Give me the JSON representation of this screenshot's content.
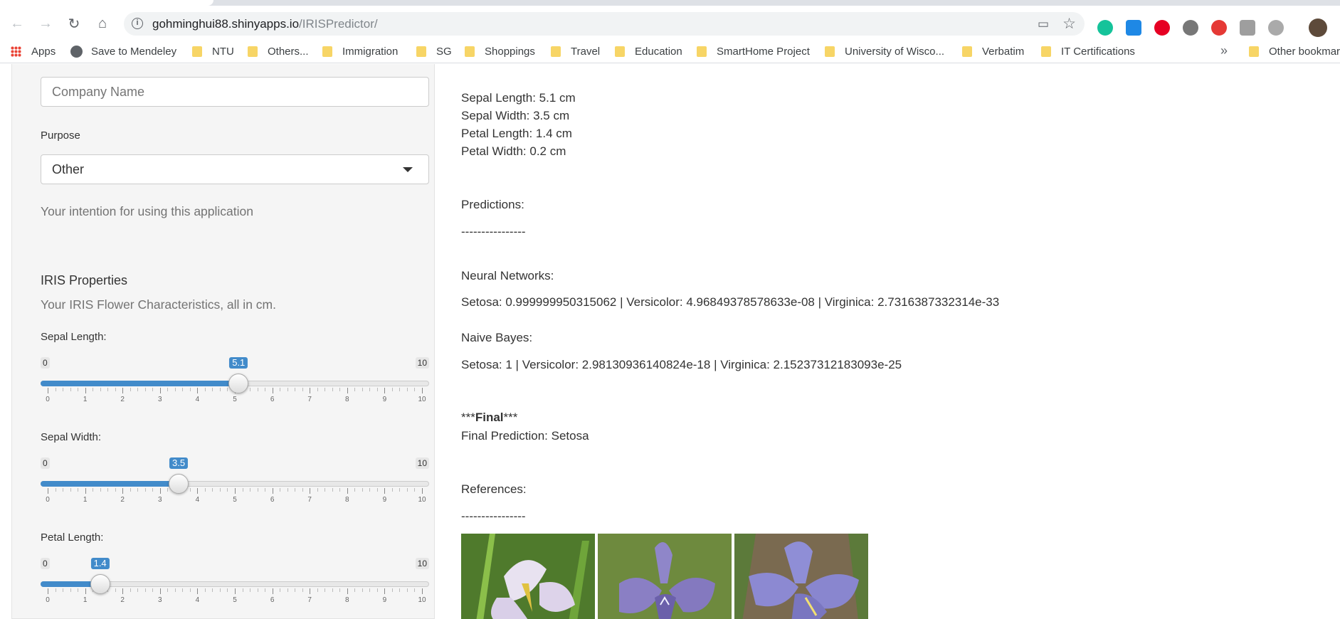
{
  "browser": {
    "url_host": "gohminghui88.shinyapps.io",
    "url_path": "/IRISPredictor/",
    "bookmarks": [
      "Apps",
      "Save to Mendeley",
      "NTU",
      "Others...",
      "Immigration",
      "SG",
      "Shoppings",
      "Travel",
      "Education",
      "SmartHome Project",
      "University of Wisco...",
      "Verbatim",
      "IT Certifications"
    ],
    "overflow": "»",
    "other_bookmarks": "Other bookmar"
  },
  "sidebar": {
    "company_placeholder": "Company Name",
    "purpose_label": "Purpose",
    "purpose_value": "Other",
    "purpose_help": "Your intention for using this application",
    "iris_title": "IRIS Properties",
    "iris_help": "Your IRIS Flower Characteristics, all in cm.",
    "sliders": [
      {
        "label": "Sepal Length:",
        "min": "0",
        "max": "10",
        "value": "5.1",
        "fraction": 0.51
      },
      {
        "label": "Sepal Width:",
        "min": "0",
        "max": "10",
        "value": "3.5",
        "fraction": 0.35
      },
      {
        "label": "Petal Length:",
        "min": "0",
        "max": "10",
        "value": "1.4",
        "fraction": 0.14
      }
    ],
    "tick_labels": [
      "0",
      "1",
      "2",
      "3",
      "4",
      "5",
      "6",
      "7",
      "8",
      "9",
      "10"
    ]
  },
  "main": {
    "sepal_length": "Sepal Length: 5.1 cm",
    "sepal_width": "Sepal Width: 3.5 cm",
    "petal_length": "Petal Length: 1.4 cm",
    "petal_width": "Petal Width: 0.2 cm",
    "predictions": "Predictions:",
    "divider1": "----------------",
    "nn_label": "Neural Networks:",
    "nn_result": "Setosa: 0.999999950315062 | Versicolor: 4.96849378578633e-08 | Virginica: 2.7316387332314e-33",
    "nb_label": "Naive Bayes:",
    "nb_result": "Setosa: 1 | Versicolor: 2.98130936140824e-18 | Virginica: 2.15237312183093e-25",
    "final_prefix": "***",
    "final_bold": "Final",
    "final_suffix": "***",
    "final_prediction": "Final Prediction: Setosa",
    "references": "References:",
    "divider2": "----------------"
  },
  "colors": {
    "accent": "#428bca"
  }
}
